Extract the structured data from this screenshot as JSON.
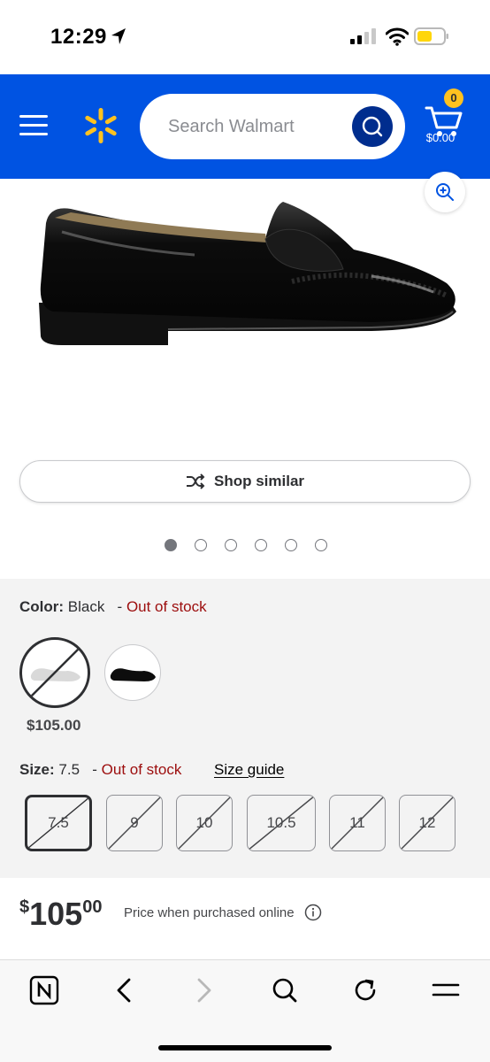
{
  "status_bar": {
    "time": "12:29"
  },
  "header": {
    "search_placeholder": "Search Walmart",
    "cart_count": "0",
    "cart_total": "$0.00",
    "brand_color": "#0053e2",
    "spark_color": "#ffc220"
  },
  "product": {
    "shop_similar_label": "Shop similar",
    "image_count": 6,
    "active_image_index": 0
  },
  "color_selector": {
    "label": "Color:",
    "value": "Black",
    "separator": "-",
    "stock_status": "Out of stock",
    "options": [
      {
        "name": "option-1",
        "price": "$105.00",
        "selected": true,
        "available": false
      },
      {
        "name": "option-2",
        "selected": false,
        "available": true
      }
    ]
  },
  "size_selector": {
    "label": "Size:",
    "value": "7.5",
    "separator": "-",
    "stock_status": "Out of stock",
    "guide_label": "Size guide",
    "sizes": [
      "7.5",
      "9",
      "10",
      "10.5",
      "11",
      "12"
    ],
    "selected_size": "7.5"
  },
  "price": {
    "currency": "$",
    "whole": "105",
    "cents": "00",
    "note": "Price when purchased online"
  },
  "browser_bar": {
    "icons": [
      "notion-icon",
      "back-icon",
      "forward-icon",
      "search-icon",
      "reload-icon",
      "menu-icon"
    ]
  }
}
